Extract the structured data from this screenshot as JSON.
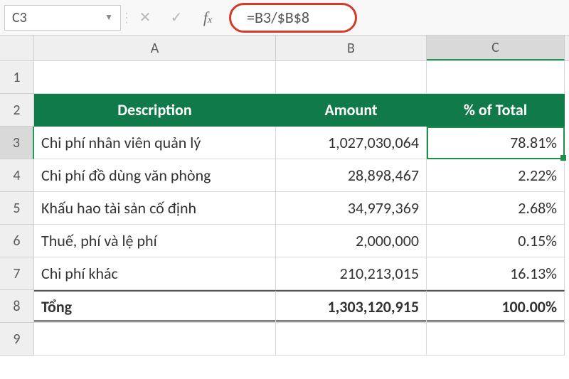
{
  "formula_bar": {
    "cell_ref": "C3",
    "formula": "=B3/$B$8"
  },
  "columns": {
    "A": "A",
    "B": "B",
    "C": "C"
  },
  "row_labels": [
    "1",
    "2",
    "3",
    "4",
    "5",
    "6",
    "7",
    "8",
    "9"
  ],
  "table": {
    "headers": {
      "desc": "Description",
      "amount": "Amount",
      "pct": "% of Total"
    },
    "rows": [
      {
        "desc": "Chi phí nhân viên quản lý",
        "amount": "1,027,030,064",
        "pct": "78.81%"
      },
      {
        "desc": "Chi phí đồ dùng văn phòng",
        "amount": "28,898,467",
        "pct": "2.22%"
      },
      {
        "desc": "Khấu hao tài sản cố định",
        "amount": "34,979,369",
        "pct": "2.68%"
      },
      {
        "desc": "Thuế, phí và lệ phí",
        "amount": "2,000,000",
        "pct": "0.15%"
      },
      {
        "desc": "Chi phí khác",
        "amount": "210,213,015",
        "pct": "16.13%"
      }
    ],
    "total": {
      "desc": "Tổng",
      "amount": "1,303,120,915",
      "pct": "100.00%"
    }
  },
  "chart_data": {
    "type": "table",
    "title": "",
    "columns": [
      "Description",
      "Amount",
      "% of Total"
    ],
    "rows": [
      [
        "Chi phí nhân viên quản lý",
        1027030064,
        78.81
      ],
      [
        "Chi phí đồ dùng văn phòng",
        28898467,
        2.22
      ],
      [
        "Khấu hao tài sản cố định",
        34979369,
        2.68
      ],
      [
        "Thuế, phí và lệ phí",
        2000000,
        0.15
      ],
      [
        "Chi phí khác",
        210213015,
        16.13
      ],
      [
        "Tổng",
        1303120915,
        100.0
      ]
    ]
  },
  "colors": {
    "header_bg": "#117a4a",
    "selection": "#1e8e4b",
    "highlight_ring": "#d63a2a"
  }
}
